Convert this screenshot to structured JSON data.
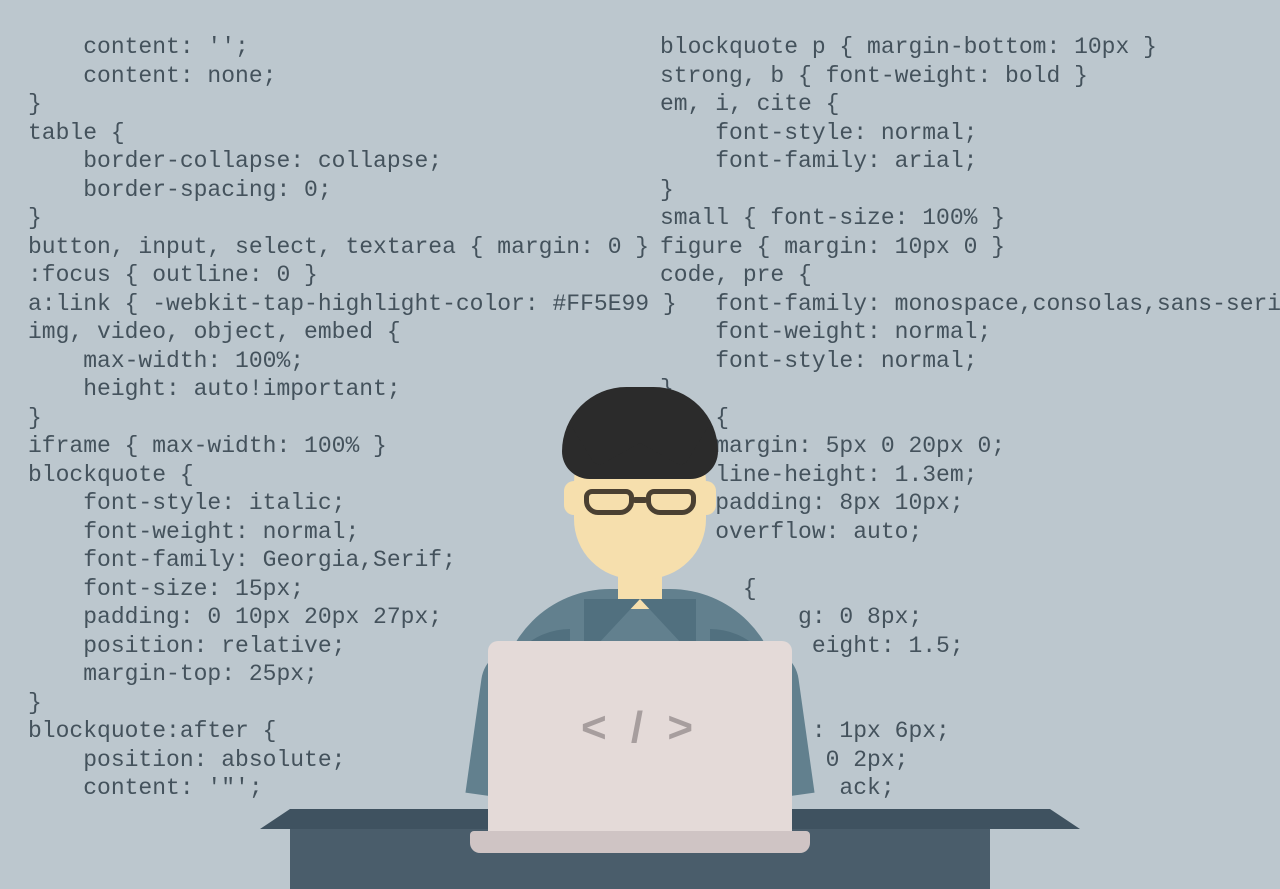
{
  "laptop_glyph": "< / >",
  "code_left": [
    "    content: '';",
    "    content: none;",
    "}",
    "table {",
    "    border-collapse: collapse;",
    "    border-spacing: 0;",
    "}",
    "button, input, select, textarea { margin: 0 }",
    ":focus { outline: 0 }",
    "a:link { -webkit-tap-highlight-color: #FF5E99 }",
    "img, video, object, embed {",
    "    max-width: 100%;",
    "    height: auto!important;",
    "}",
    "iframe { max-width: 100% }",
    "blockquote {",
    "    font-style: italic;",
    "    font-weight: normal;",
    "    font-family: Georgia,Serif;",
    "    font-size: 15px;",
    "    padding: 0 10px 20px 27px;",
    "    position: relative;",
    "    margin-top: 25px;",
    "}",
    "blockquote:after {",
    "    position: absolute;",
    "    content: '\"';"
  ],
  "code_right": [
    "blockquote p { margin-bottom: 10px }",
    "strong, b { font-weight: bold }",
    "em, i, cite {",
    "    font-style: normal;",
    "    font-family: arial;",
    "}",
    "small { font-size: 100% }",
    "figure { margin: 10px 0 }",
    "code, pre {",
    "    font-family: monospace,consolas,sans-serif;",
    "    font-weight: normal;",
    "    font-style: normal;",
    "}",
    "pre {",
    "    margin: 5px 0 20px 0;",
    "    line-height: 1.3em;",
    "    padding: 8px 10px;",
    "    overflow: auto;",
    "}",
    "      {",
    "          g: 0 8px;",
    "           eight: 1.5;",
    "}",
    "        {",
    "           : 1px 6px;",
    "            0 2px;",
    "             ack;"
  ]
}
